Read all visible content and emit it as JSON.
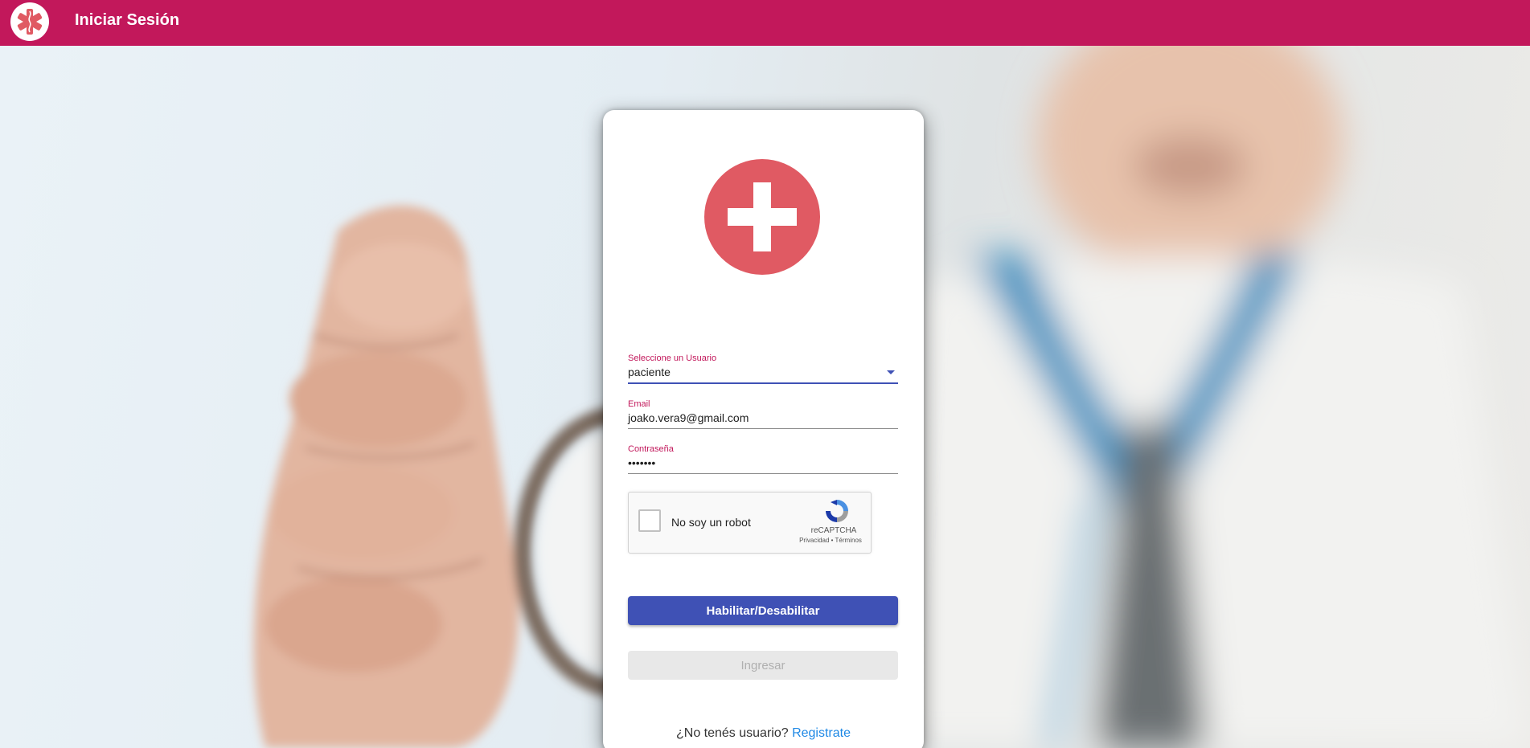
{
  "toolbar": {
    "title": "Iniciar Sesión",
    "logo_icon": "medical-star-icon",
    "color": "#c2185b"
  },
  "login": {
    "logo_icon": "medical-cross-icon",
    "user_type": {
      "label": "Seleccione un Usuario",
      "value": "paciente"
    },
    "email": {
      "label": "Email",
      "value": "joako.vera9@gmail.com"
    },
    "password": {
      "label": "Contraseña",
      "value": "•••••••"
    },
    "recaptcha": {
      "label": "No soy un robot",
      "brand": "reCAPTCHA",
      "links": "Privacidad • Términos"
    },
    "toggle_button": "Habilitar/Desabilitar",
    "submit_button": "Ingresar",
    "register_prompt": "¿No tenés usuario?",
    "register_link": "Registrate"
  },
  "colors": {
    "primary": "#3f51b5",
    "accent": "#c2185b",
    "logo_red": "#e05a63",
    "link": "#1e88e5"
  }
}
